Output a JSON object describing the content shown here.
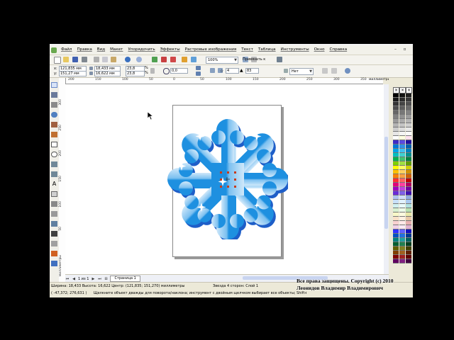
{
  "menu": {
    "items": [
      "Файл",
      "Правка",
      "Вид",
      "Макет",
      "Упорядочить",
      "Эффекты",
      "Растровые изображения",
      "Текст",
      "Таблица",
      "Инструменты",
      "Окно",
      "Справка"
    ]
  },
  "toolbar_standard": {
    "zoom": "100%",
    "snap": "Привязать к"
  },
  "property_bar": {
    "x": "121,835 мм",
    "y": "151,27 мм",
    "width": "18,433 мм",
    "height": "16,622 мм",
    "scale_x": "23,8",
    "scale_y": "23,8",
    "percent": "%",
    "angle": "0,0",
    "points": "4",
    "sharpness": "83",
    "outline": "Нет"
  },
  "ruler": {
    "h_ticks": [
      "200",
      "150",
      "100",
      "50",
      "0",
      "50",
      "100",
      "150",
      "200",
      "250",
      "300",
      "350"
    ],
    "v_ticks": [
      "300",
      "250",
      "200",
      "150",
      "100",
      "50"
    ],
    "unit": "миллиметры",
    "v_unit": "миллиметры"
  },
  "page_nav": {
    "count": "1 из 1",
    "tab": "Страница 1"
  },
  "status": {
    "line1_left": "Ширина: 18,433  Высота: 16,622  Центр: (121,835; 151,270)  миллиметры",
    "line1_right": "Звезда  4 сторон: Слой 1",
    "line2_left": "( -47,372; 276,631 )",
    "line2_right": "Щелкните объект дважды для поворота/наклона; инструмент с двойным щелчком выбирает все объекты; Shift+щелчок"
  },
  "watermark": {
    "line1": "Все права защищены. Copyright (c) 2010",
    "line2": "Леонидов Владимир Владимирович"
  },
  "colors": {
    "snowflake": "#1e90e0",
    "snowflake_light": "#a8d4f4",
    "shadow": "#1e5ec8"
  },
  "palette": {
    "col1": [
      "#000000",
      "#1a1a1a",
      "#333333",
      "#4d4d4d",
      "#666666",
      "#808080",
      "#999999",
      "#b3b3b3",
      "#cccccc",
      "#e6e6e6",
      "#ffffff",
      "#3d2bc7",
      "#0078d7",
      "#00a2e8",
      "#00c0c0",
      "#00b050",
      "#7fd000",
      "#ffff00",
      "#ffc000",
      "#ff8000",
      "#ff3030",
      "#e0007a",
      "#a000c0",
      "#6a2bd8",
      "#b0c4f0",
      "#c8e0f8",
      "#d0f0f0",
      "#d8f0d0",
      "#f8f8c8",
      "#f8e0c8",
      "#f8d0d0",
      "#f0d0e8",
      "#3030ff",
      "#0050c0",
      "#008080",
      "#006030",
      "#606000",
      "#804000",
      "#800000",
      "#600060"
    ],
    "col2": [
      "#111111",
      "#2b2b2b",
      "#444444",
      "#5e5e5e",
      "#777777",
      "#919191",
      "#aaaaaa",
      "#c4c4c4",
      "#dddddd",
      "#f5f5f5",
      "#ffffe0",
      "#5a4ae0",
      "#3090e8",
      "#40c0f0",
      "#40d0d0",
      "#40c070",
      "#a0e040",
      "#ffff60",
      "#ffd060",
      "#ffa040",
      "#ff6060",
      "#ff40a0",
      "#c040e0",
      "#8060e8",
      "#d0dcf8",
      "#e0f0ff",
      "#e8fafa",
      "#ecfae8",
      "#fffce0",
      "#fff0e0",
      "#ffe8e8",
      "#f8e8f4",
      "#6060ff",
      "#2070e0",
      "#20a0a0",
      "#208050",
      "#808020",
      "#a06020",
      "#a02020",
      "#802080"
    ],
    "col3": [
      "#202020",
      "#383838",
      "#505050",
      "#6a6a6a",
      "#838383",
      "#9c9c9c",
      "#b5b5b5",
      "#cecece",
      "#e8e8e8",
      "#fafafa",
      "#ffe0f0",
      "#2010a0",
      "#0060b0",
      "#0080c0",
      "#008f8f",
      "#008040",
      "#60a000",
      "#d0d000",
      "#d09000",
      "#d06000",
      "#c00000",
      "#b00060",
      "#7000a0",
      "#4010b0",
      "#90a8e0",
      "#a8c8f0",
      "#b0e0e0",
      "#b8e0b0",
      "#e8e8a8",
      "#e8c8a8",
      "#e8b0b0",
      "#e0b0d0",
      "#1010c0",
      "#003890",
      "#006060",
      "#004020",
      "#404000",
      "#602000",
      "#600000",
      "#400040"
    ]
  }
}
